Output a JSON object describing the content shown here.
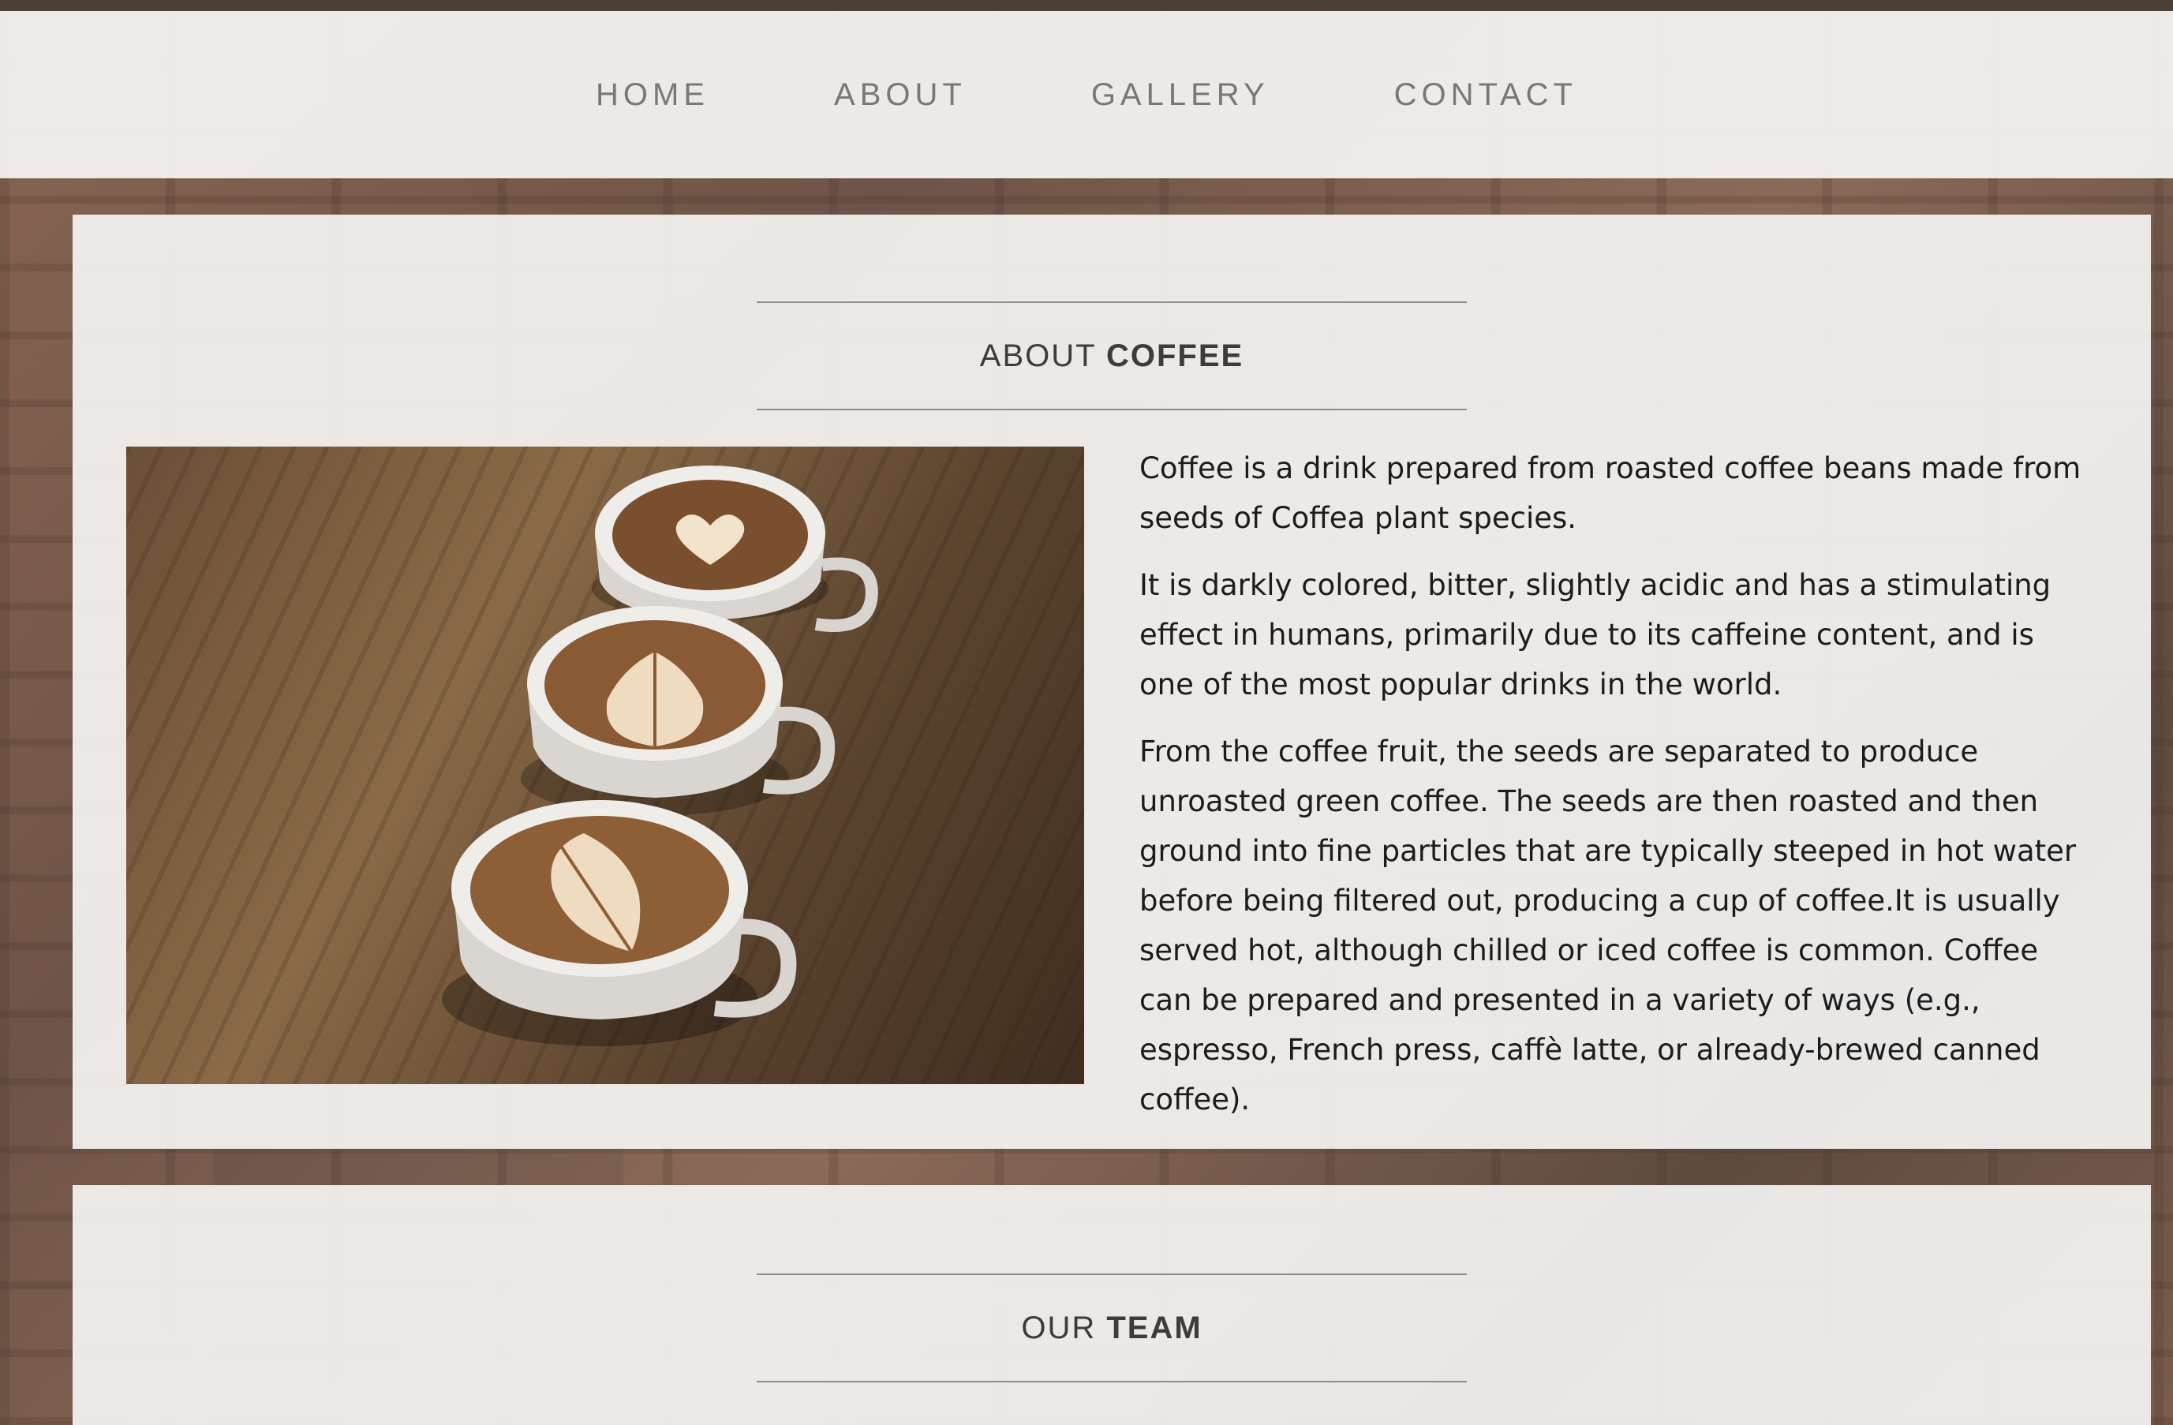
{
  "nav": {
    "items": [
      {
        "label": "HOME"
      },
      {
        "label": "ABOUT"
      },
      {
        "label": "GALLERY"
      },
      {
        "label": "CONTACT"
      }
    ]
  },
  "about": {
    "heading_light": "ABOUT ",
    "heading_bold": "COFFEE",
    "paragraphs": [
      "Coffee is a drink prepared from roasted coffee beans made from seeds of Coffea plant species.",
      "It is darkly colored, bitter, slightly acidic and has a stimulating effect in humans, primarily due to its caffeine content, and is one of the most popular drinks in the world.",
      "From the coffee fruit, the seeds are separated to produce unroasted green coffee. The seeds are then roasted and then ground into fine particles that are typically steeped in hot water before being filtered out, producing a cup of coffee.It is usually served hot, although chilled or iced coffee is common. Coffee can be prepared and presented in a variety of ways (e.g., espresso, French press, caffè latte, or already-brewed canned coffee)."
    ]
  },
  "team": {
    "heading_light": "OUR ",
    "heading_bold": "TEAM"
  },
  "colors": {
    "nav_text": "#7a7777",
    "heading_text": "#3d3b3b",
    "panel_bg": "#f5f4f3"
  }
}
